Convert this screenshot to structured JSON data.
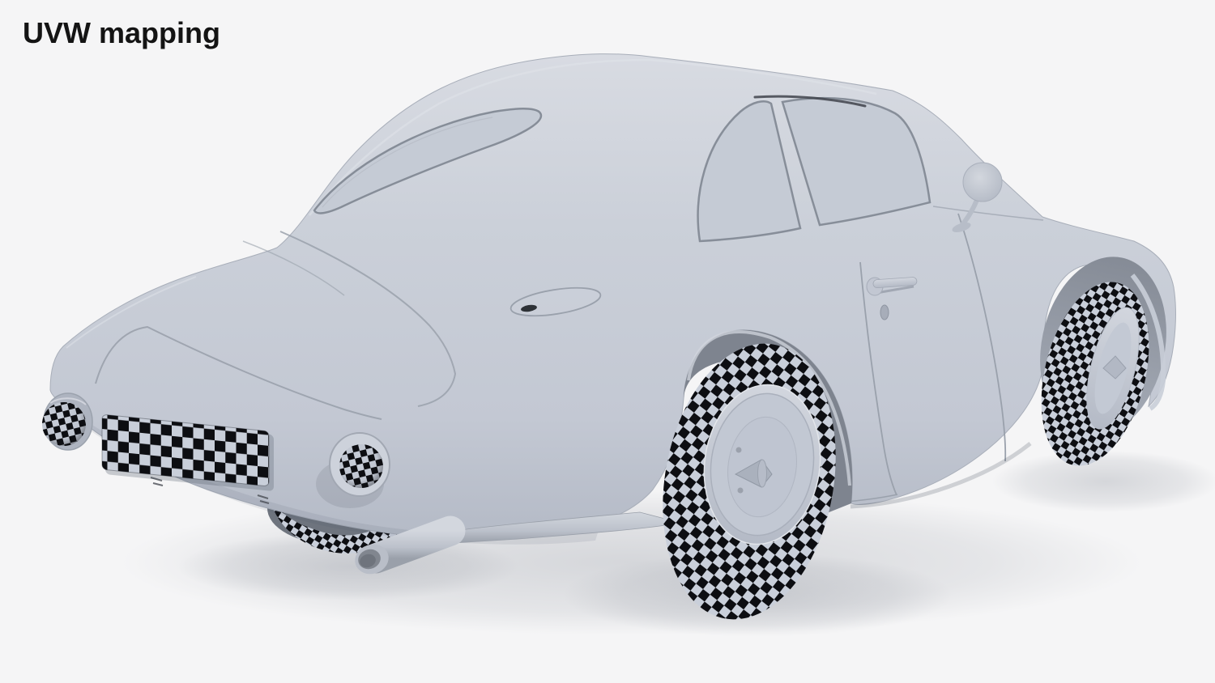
{
  "header": {
    "title": "UVW mapping"
  },
  "colors": {
    "background": "#f5f5f6",
    "body": "#c7ccd6",
    "body_light": "#d6dae1",
    "body_dark": "#b2b8c4",
    "outline": "#9aa1ac",
    "checker_light": "#c9cfda",
    "checker_dark": "#0d0e12",
    "text": "#141414"
  }
}
